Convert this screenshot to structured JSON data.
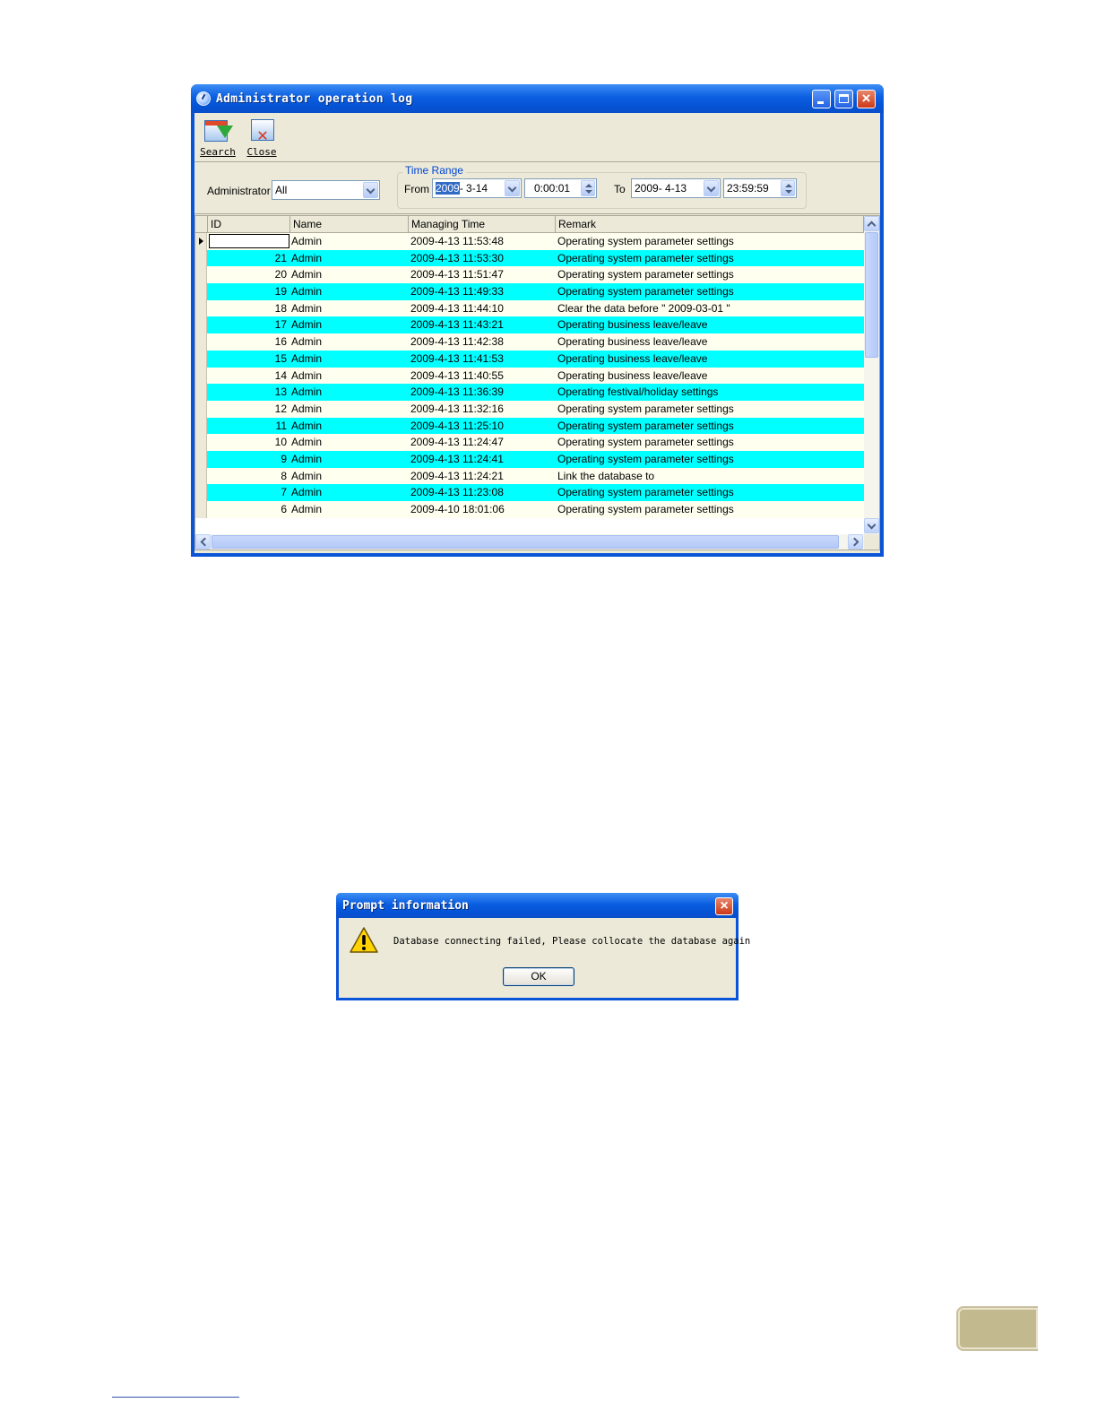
{
  "main_window": {
    "title": "Administrator operation log",
    "toolbar": {
      "search_label": "Search",
      "close_label": "Close"
    },
    "filter": {
      "administrator_label": "Administrator",
      "administrator_value": "All",
      "time_range_caption": "Time Range",
      "from_label": "From",
      "from_date_selected": "2009",
      "from_date_rest": "-  3-14",
      "from_time": "0:00:01",
      "to_label": "To",
      "to_date": "2009-  4-13",
      "to_time": "23:59:59"
    },
    "grid": {
      "columns": [
        "ID",
        "Name",
        "Managing Time",
        "Remark"
      ],
      "rows": [
        {
          "id": "",
          "name": "Admin",
          "time": "2009-4-13 11:53:48",
          "remark": "Operating system parameter settings"
        },
        {
          "id": "21",
          "name": "Admin",
          "time": "2009-4-13 11:53:30",
          "remark": "Operating system parameter settings"
        },
        {
          "id": "20",
          "name": "Admin",
          "time": "2009-4-13 11:51:47",
          "remark": "Operating system parameter settings"
        },
        {
          "id": "19",
          "name": "Admin",
          "time": "2009-4-13 11:49:33",
          "remark": "Operating system parameter settings"
        },
        {
          "id": "18",
          "name": "Admin",
          "time": "2009-4-13 11:44:10",
          "remark": "Clear the data before \" 2009-03-01 \""
        },
        {
          "id": "17",
          "name": "Admin",
          "time": "2009-4-13 11:43:21",
          "remark": "Operating business leave/leave"
        },
        {
          "id": "16",
          "name": "Admin",
          "time": "2009-4-13 11:42:38",
          "remark": "Operating business leave/leave"
        },
        {
          "id": "15",
          "name": "Admin",
          "time": "2009-4-13 11:41:53",
          "remark": "Operating business leave/leave"
        },
        {
          "id": "14",
          "name": "Admin",
          "time": "2009-4-13 11:40:55",
          "remark": "Operating business leave/leave"
        },
        {
          "id": "13",
          "name": "Admin",
          "time": "2009-4-13 11:36:39",
          "remark": "Operating festival/holiday settings"
        },
        {
          "id": "12",
          "name": "Admin",
          "time": "2009-4-13 11:32:16",
          "remark": "Operating system parameter settings"
        },
        {
          "id": "11",
          "name": "Admin",
          "time": "2009-4-13 11:25:10",
          "remark": "Operating system parameter settings"
        },
        {
          "id": "10",
          "name": "Admin",
          "time": "2009-4-13 11:24:47",
          "remark": "Operating system parameter settings"
        },
        {
          "id": "9",
          "name": "Admin",
          "time": "2009-4-13 11:24:41",
          "remark": "Operating system parameter settings"
        },
        {
          "id": "8",
          "name": "Admin",
          "time": "2009-4-13 11:24:21",
          "remark": "Link the database to"
        },
        {
          "id": "7",
          "name": "Admin",
          "time": "2009-4-13 11:23:08",
          "remark": "Operating system parameter settings"
        },
        {
          "id": "6",
          "name": "Admin",
          "time": "2009-4-10 18:01:06",
          "remark": "Operating system parameter settings"
        }
      ]
    }
  },
  "prompt_dialog": {
    "title": "Prompt information",
    "message": "Database connecting failed, Please collocate the database again",
    "ok_label": "OK"
  },
  "colors": {
    "row_light": "#fffff0",
    "row_cyan": "#00ffff",
    "titlebar": "#0a54d8",
    "window_face": "#ece9d8"
  }
}
